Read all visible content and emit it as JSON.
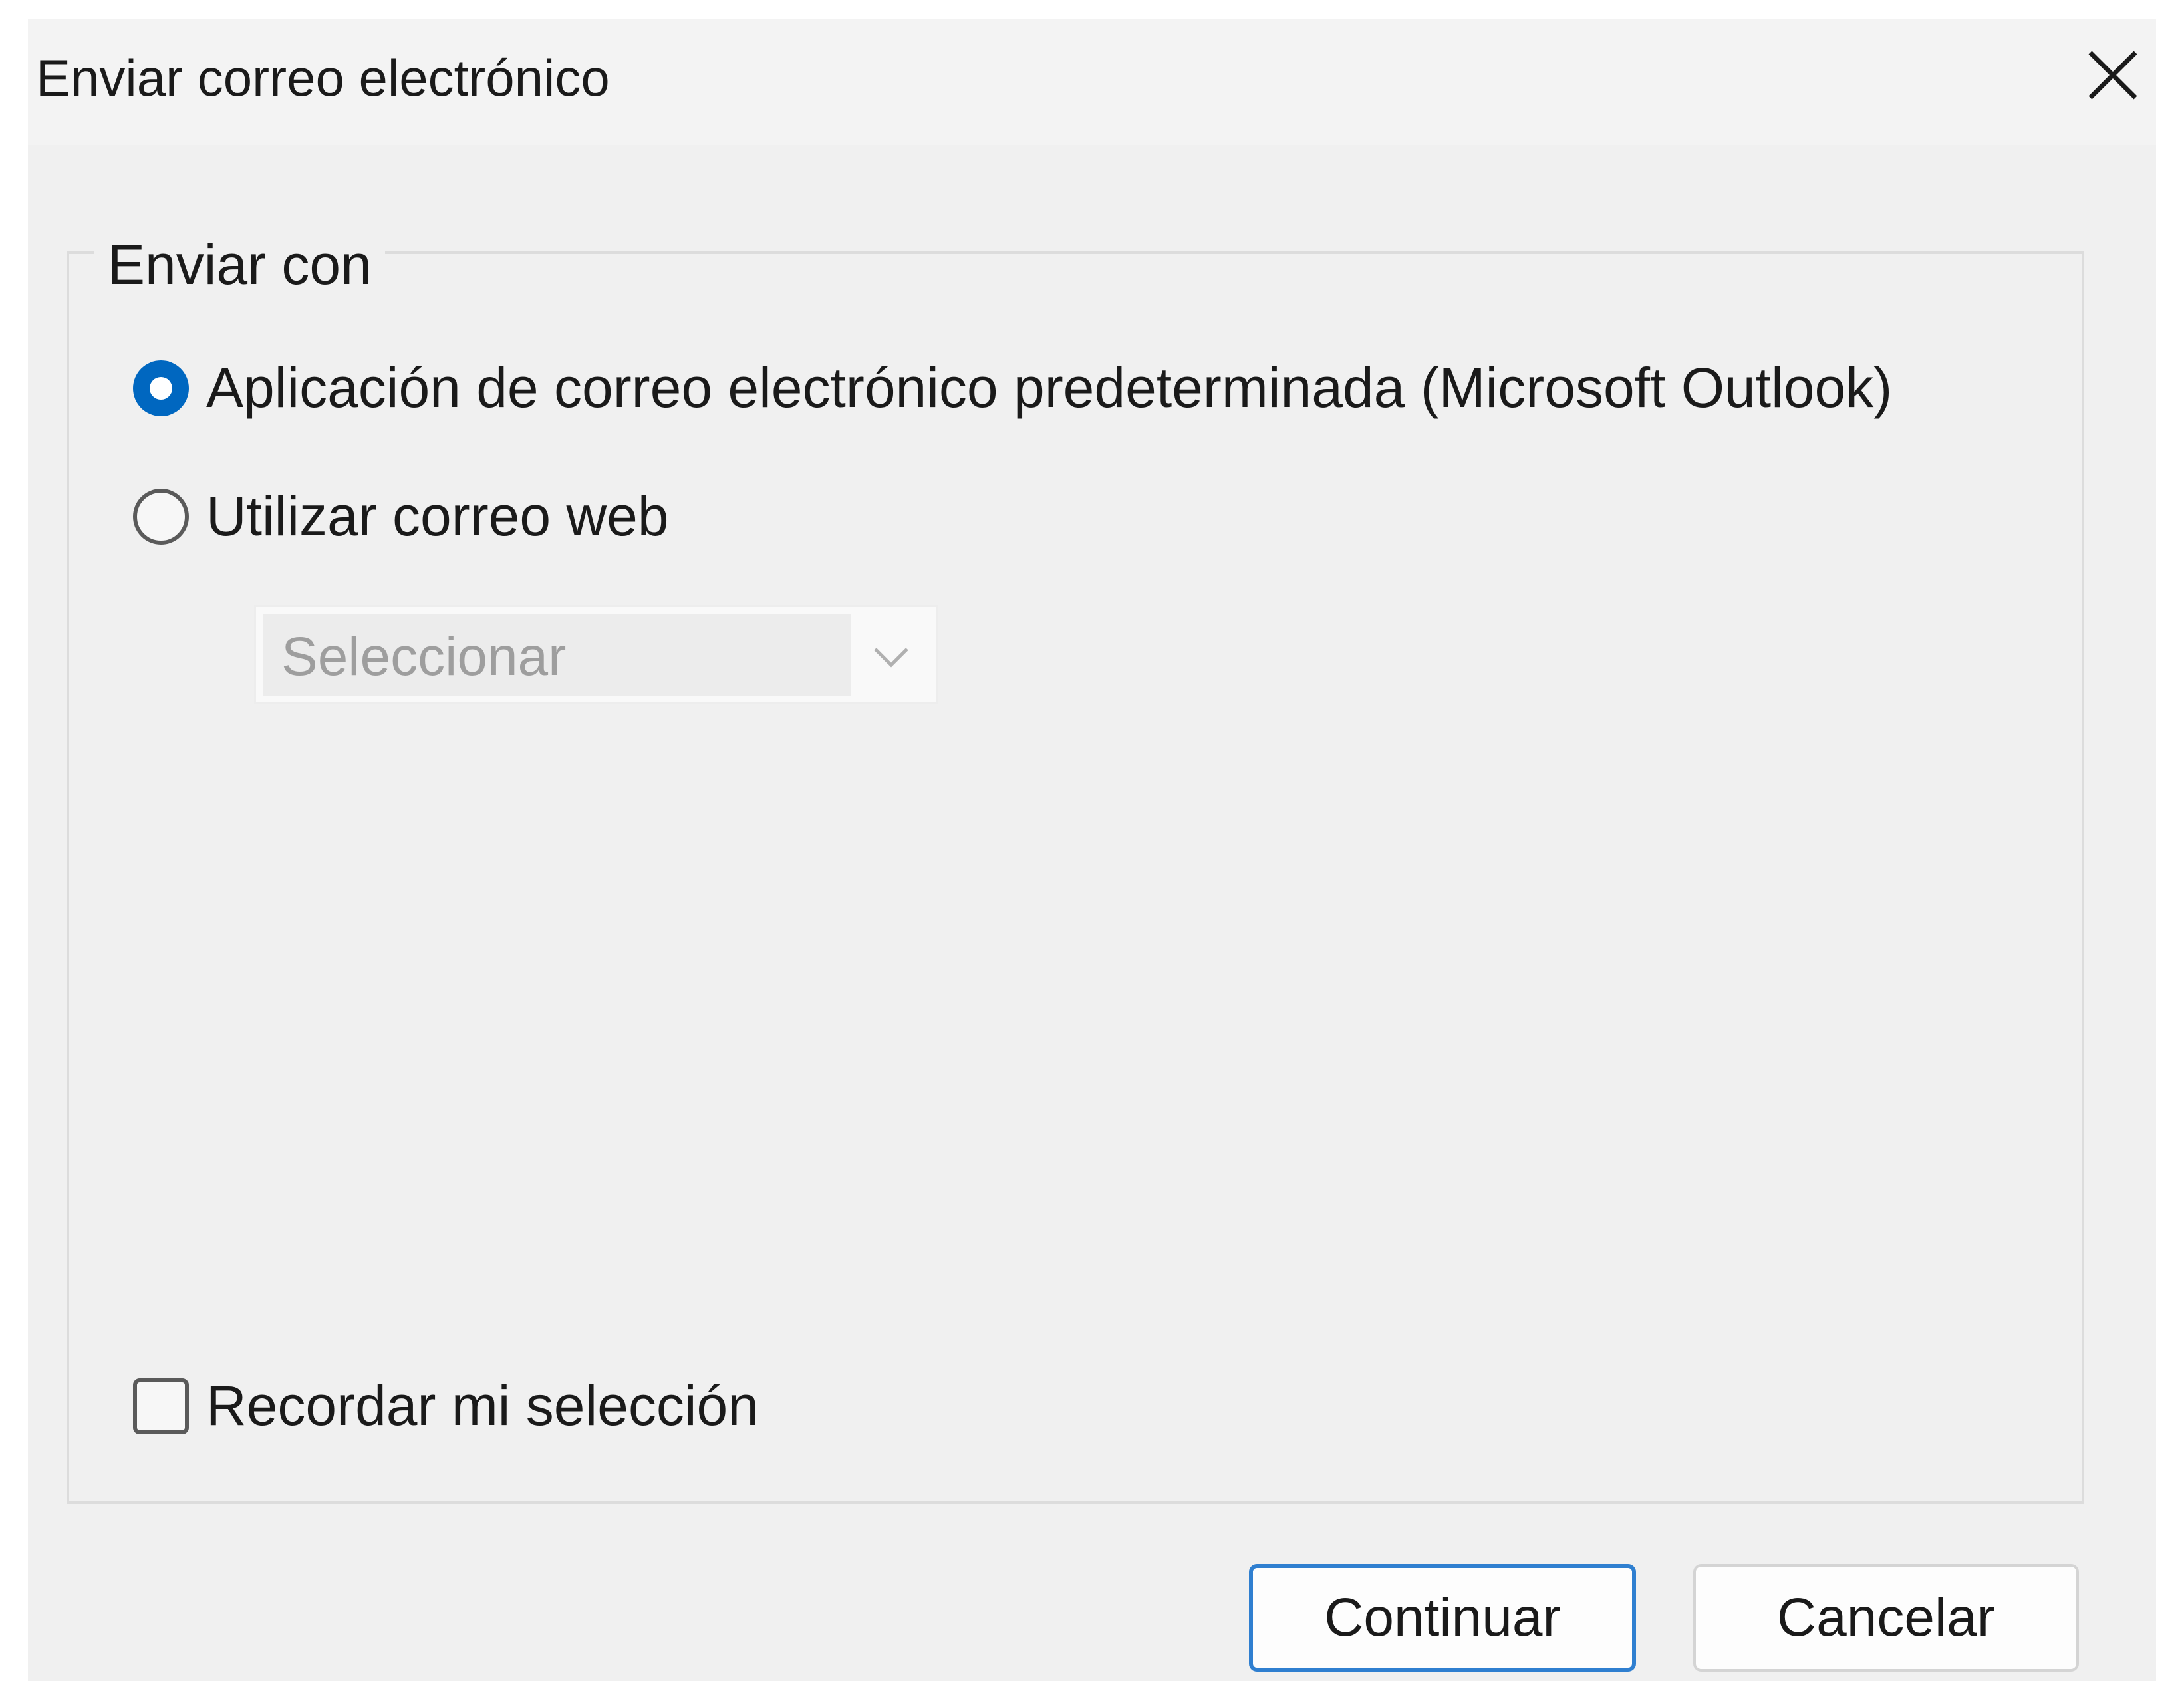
{
  "dialog": {
    "title": "Enviar correo electrónico",
    "close_icon": "close-icon"
  },
  "group": {
    "legend": "Enviar con",
    "options": [
      {
        "label": "Aplicación de correo electrónico predeterminada (Microsoft Outlook)",
        "selected": true
      },
      {
        "label": "Utilizar correo web",
        "selected": false
      }
    ],
    "webmail_select": {
      "value": "Seleccionar",
      "enabled": false,
      "arrow_icon": "chevron-down-icon"
    },
    "remember": {
      "label": "Recordar mi selección",
      "checked": false
    }
  },
  "buttons": {
    "continue_label": "Continuar",
    "cancel_label": "Cancelar"
  },
  "colors": {
    "accent": "#0067c0",
    "primary_button_border": "#2f7fd0",
    "dialog_background": "#f0f0f0"
  }
}
